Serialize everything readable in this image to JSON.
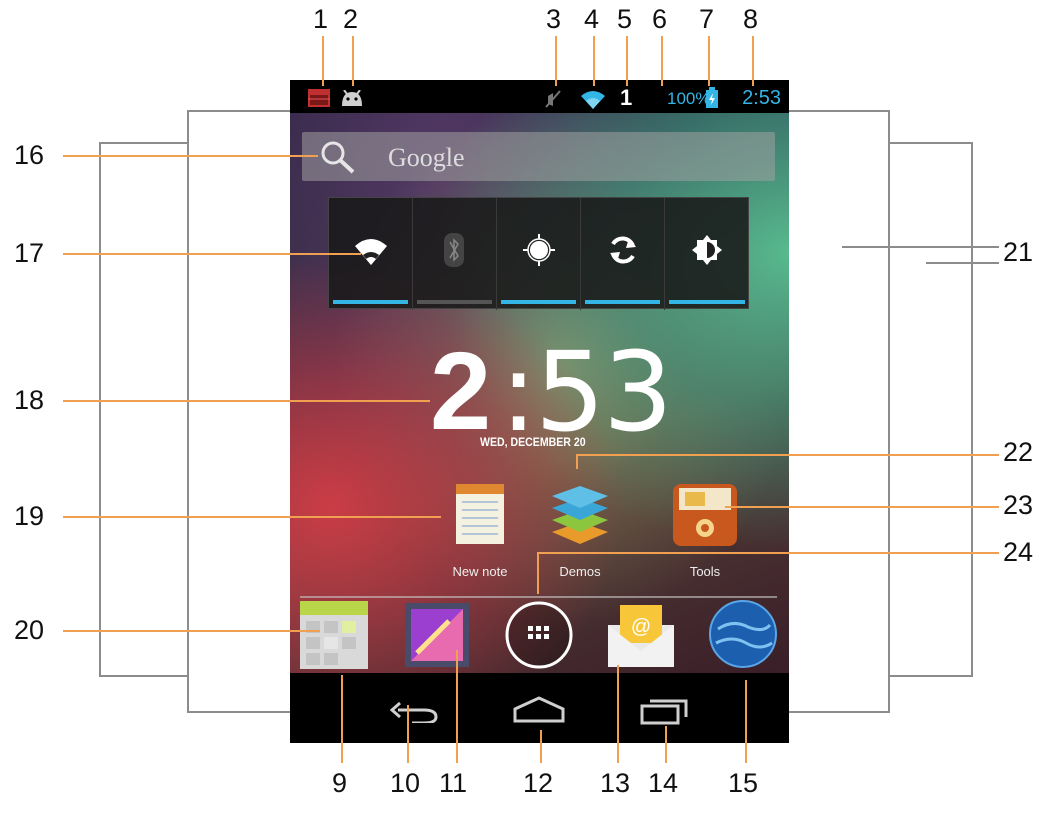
{
  "callouts": {
    "n1": "1",
    "n2": "2",
    "n3": "3",
    "n4": "4",
    "n5": "5",
    "n6": "6",
    "n7": "7",
    "n8": "8",
    "n9": "9",
    "n10": "10",
    "n11": "11",
    "n12": "12",
    "n13": "13",
    "n14": "14",
    "n15": "15",
    "n16": "16",
    "n17": "17",
    "n18": "18",
    "n19": "19",
    "n20": "20",
    "n21": "21",
    "n22": "22",
    "n23": "23",
    "n24": "24"
  },
  "status_bar": {
    "signal_count": "1",
    "battery_percent": "100%",
    "time": "2:53",
    "icons": [
      "notification-calendar-icon",
      "android-debug-icon",
      "mute-icon",
      "wifi-icon",
      "battery-charging-icon"
    ]
  },
  "search": {
    "placeholder": "Google",
    "icon": "search-icon"
  },
  "power_widget": {
    "toggles": [
      {
        "icon": "wifi-icon",
        "on": true
      },
      {
        "icon": "bluetooth-icon",
        "on": false
      },
      {
        "icon": "gps-icon",
        "on": true
      },
      {
        "icon": "sync-icon",
        "on": true
      },
      {
        "icon": "brightness-icon",
        "on": true
      }
    ]
  },
  "clock": {
    "hour": "2",
    "minutes": ":53",
    "date": "WED, DECEMBER 20"
  },
  "apps": [
    {
      "label": "New note",
      "icon": "notepad-icon"
    },
    {
      "label": "Demos",
      "icon": "layers-icon"
    },
    {
      "label": "Tools",
      "icon": "toolbox-icon"
    }
  ],
  "dock": [
    "calendar-icon",
    "gallery-icon",
    "app-drawer-icon",
    "email-icon",
    "browser-globe-icon"
  ],
  "nav": [
    "back-icon",
    "home-icon",
    "recent-apps-icon"
  ],
  "colors": {
    "accent": "#33b5e5",
    "leader": "#f0a050",
    "frame": "#8c8c8c"
  }
}
